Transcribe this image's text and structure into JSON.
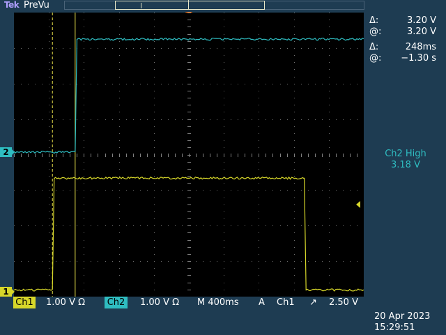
{
  "header": {
    "brand": "Tek",
    "mode": "PreVu"
  },
  "channel_markers": {
    "ch1": "1",
    "ch2": "2"
  },
  "cursor_readout": {
    "voltage_delta_symbol": "Δ:",
    "voltage_delta": "3.20 V",
    "voltage_at_symbol": "@:",
    "voltage_at": "3.20 V",
    "time_delta_symbol": "Δ:",
    "time_delta": "248ms",
    "time_at_symbol": "@:",
    "time_at": "−1.30 s"
  },
  "measurement": {
    "label": "Ch2 High",
    "value": "3.18 V"
  },
  "status_bar": {
    "ch1_label": "Ch1",
    "ch1_scale": "1.00 V Ω",
    "ch2_label": "Ch2",
    "ch2_scale": "1.00 V Ω",
    "timebase": "M 400ms",
    "trigger_mode": "A",
    "trigger_source": "Ch1",
    "trigger_edge": "↗",
    "trigger_level": "2.50 V"
  },
  "datetime": {
    "date": "20 Apr  2023",
    "time": "15:29:51"
  },
  "colors": {
    "ch1": "#d7d72a",
    "ch2": "#2fbdc1",
    "background": "#1e3c52",
    "trigger_marker": "#ff7d20"
  },
  "chart_data": {
    "type": "line",
    "x_unit": "s",
    "time_per_division": 0.4,
    "volts_per_division": 1.0,
    "series": [
      {
        "name": "Ch1",
        "color": "#d7d72a",
        "points_div": [
          [
            0,
            0.05
          ],
          [
            1.1,
            0.05
          ],
          [
            1.15,
            3.2
          ],
          [
            8.3,
            3.2
          ],
          [
            8.35,
            0.05
          ],
          [
            10,
            0.05
          ]
        ]
      },
      {
        "name": "Ch2",
        "color": "#2fbdc1",
        "points_div": [
          [
            0,
            0.0
          ],
          [
            1.75,
            0.0
          ],
          [
            1.8,
            3.18
          ],
          [
            10,
            3.18
          ]
        ]
      }
    ],
    "cursors_time_div": [
      1.1,
      1.75
    ]
  }
}
